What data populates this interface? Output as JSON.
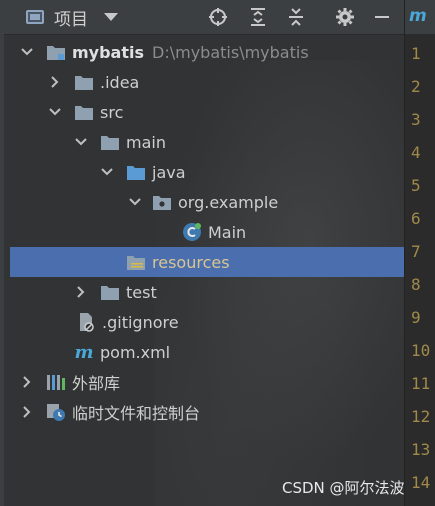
{
  "header": {
    "title": "项目"
  },
  "tree": {
    "root": {
      "name": "mybatis",
      "path": "D:\\mybatis\\mybatis"
    },
    "idea": ".idea",
    "src": "src",
    "main": "main",
    "java": "java",
    "package": "org.example",
    "main_class": "Main",
    "resources": "resources",
    "test": "test",
    "gitignore": ".gitignore",
    "pom": "pom.xml",
    "external_libs": "外部库",
    "scratches": "临时文件和控制台"
  },
  "editor": {
    "tab_letter": "m",
    "line_numbers": [
      "1",
      "2",
      "3",
      "4",
      "5",
      "6",
      "7",
      "8",
      "9",
      "10",
      "11",
      "12",
      "13",
      "14"
    ]
  },
  "watermark": "CSDN @阿尔法波",
  "colors": {
    "panel_bg": "#313335",
    "header_bg": "#3c3f41",
    "selection": "#4b6eaf",
    "folder": "#8fa0b1",
    "java_folder": "#5b9bd5",
    "line_number": "#a08a4a"
  }
}
